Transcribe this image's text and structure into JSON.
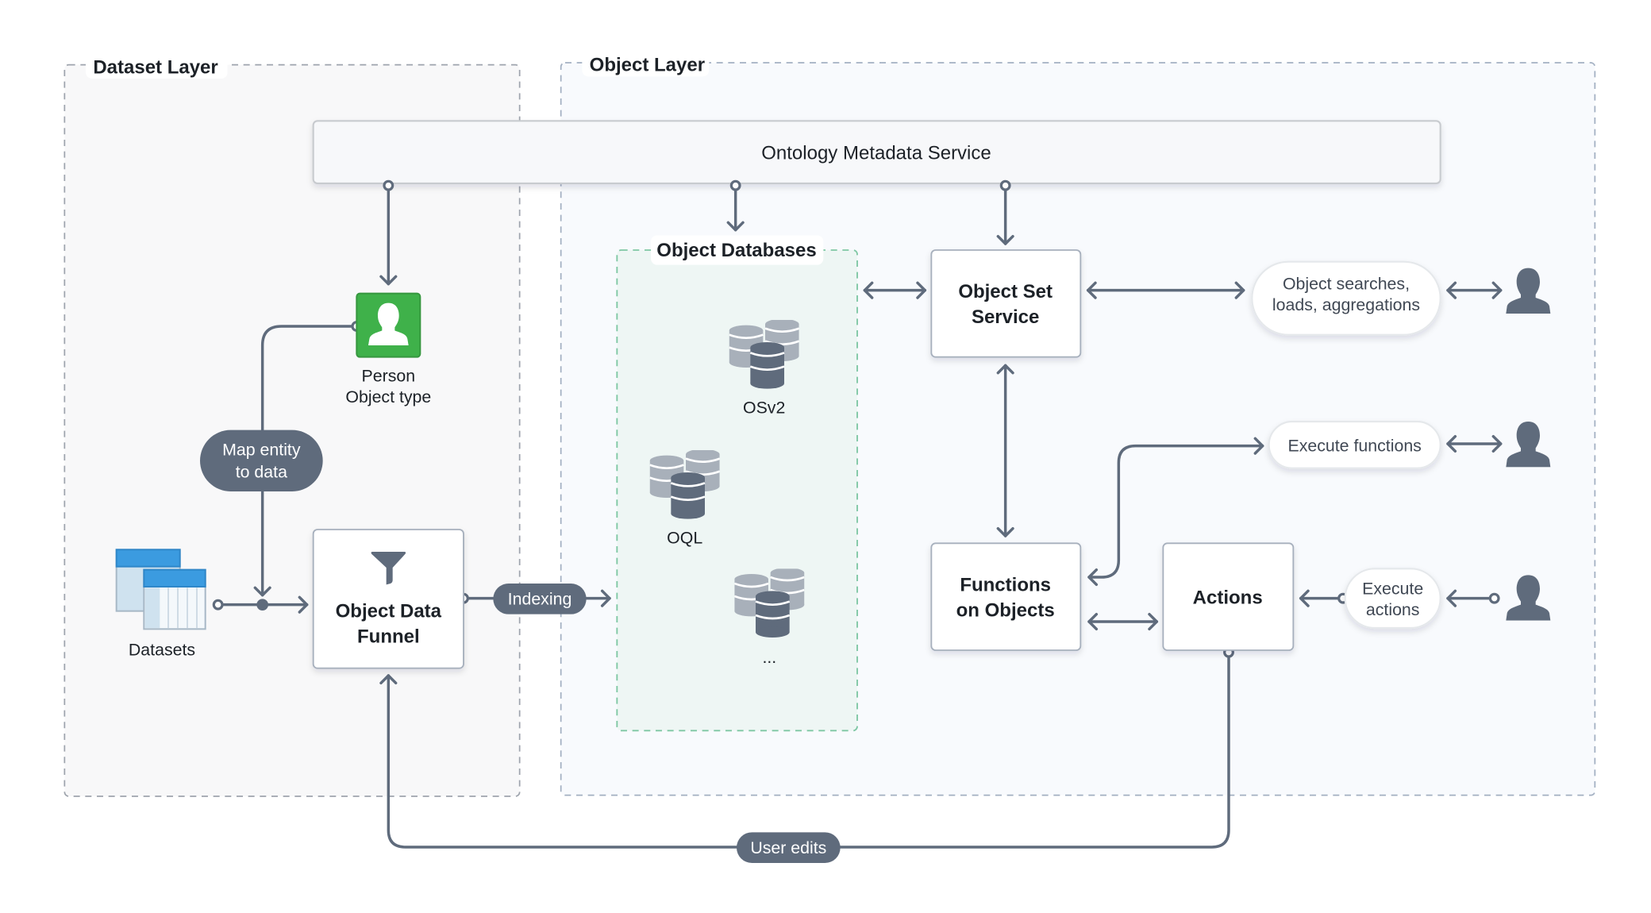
{
  "colors": {
    "connector": "#5f6b7c",
    "dataset_layer_bg": "#f8f8f9",
    "object_layer_bg": "#f8fafd",
    "object_db_bg": "#eef6f4",
    "object_db_border": "#7fc7a4",
    "person_object_green": "#3fb14a",
    "dataset_blue": "#3b9be0",
    "db_light": "#a8b0ba",
    "db_dark": "#5f6b7c",
    "user_icon": "#5f6b7c"
  },
  "layers": {
    "dataset_layer": {
      "title": "Dataset Layer"
    },
    "object_layer": {
      "title": "Object Layer"
    }
  },
  "ontology_metadata_service": {
    "label": "Ontology Metadata Service"
  },
  "dataset_layer": {
    "person_object": {
      "line1": "Person",
      "line2": "Object type",
      "icon": "person-icon"
    },
    "map_entity": {
      "line1": "Map entity",
      "line2": "to data"
    },
    "datasets": {
      "label": "Datasets",
      "icon": "dataset-table-icon"
    },
    "object_data_funnel": {
      "line1": "Object Data",
      "line2": "Funnel",
      "icon": "funnel-icon"
    }
  },
  "indexing": {
    "label": "Indexing"
  },
  "object_databases": {
    "title": "Object Databases",
    "items": [
      {
        "label": "OSv2",
        "icon": "database-icon"
      },
      {
        "label": "OQL",
        "icon": "database-icon"
      },
      {
        "label": "...",
        "icon": "database-icon"
      }
    ]
  },
  "object_set_service": {
    "line1": "Object Set",
    "line2": "Service"
  },
  "functions_on_objects": {
    "line1": "Functions",
    "line2": "on Objects"
  },
  "actions": {
    "label": "Actions"
  },
  "capabilities": {
    "searches": {
      "line1": "Object searches,",
      "line2": "loads, aggregations"
    },
    "execute_functions": {
      "label": "Execute functions"
    },
    "execute_actions": {
      "line1": "Execute",
      "line2": "actions"
    }
  },
  "users": [
    {
      "icon": "user-icon",
      "interaction": "Object searches, loads, aggregations"
    },
    {
      "icon": "user-icon",
      "interaction": "Execute functions"
    },
    {
      "icon": "user-icon",
      "interaction": "Execute actions"
    }
  ],
  "user_edits": {
    "label": "User edits"
  }
}
